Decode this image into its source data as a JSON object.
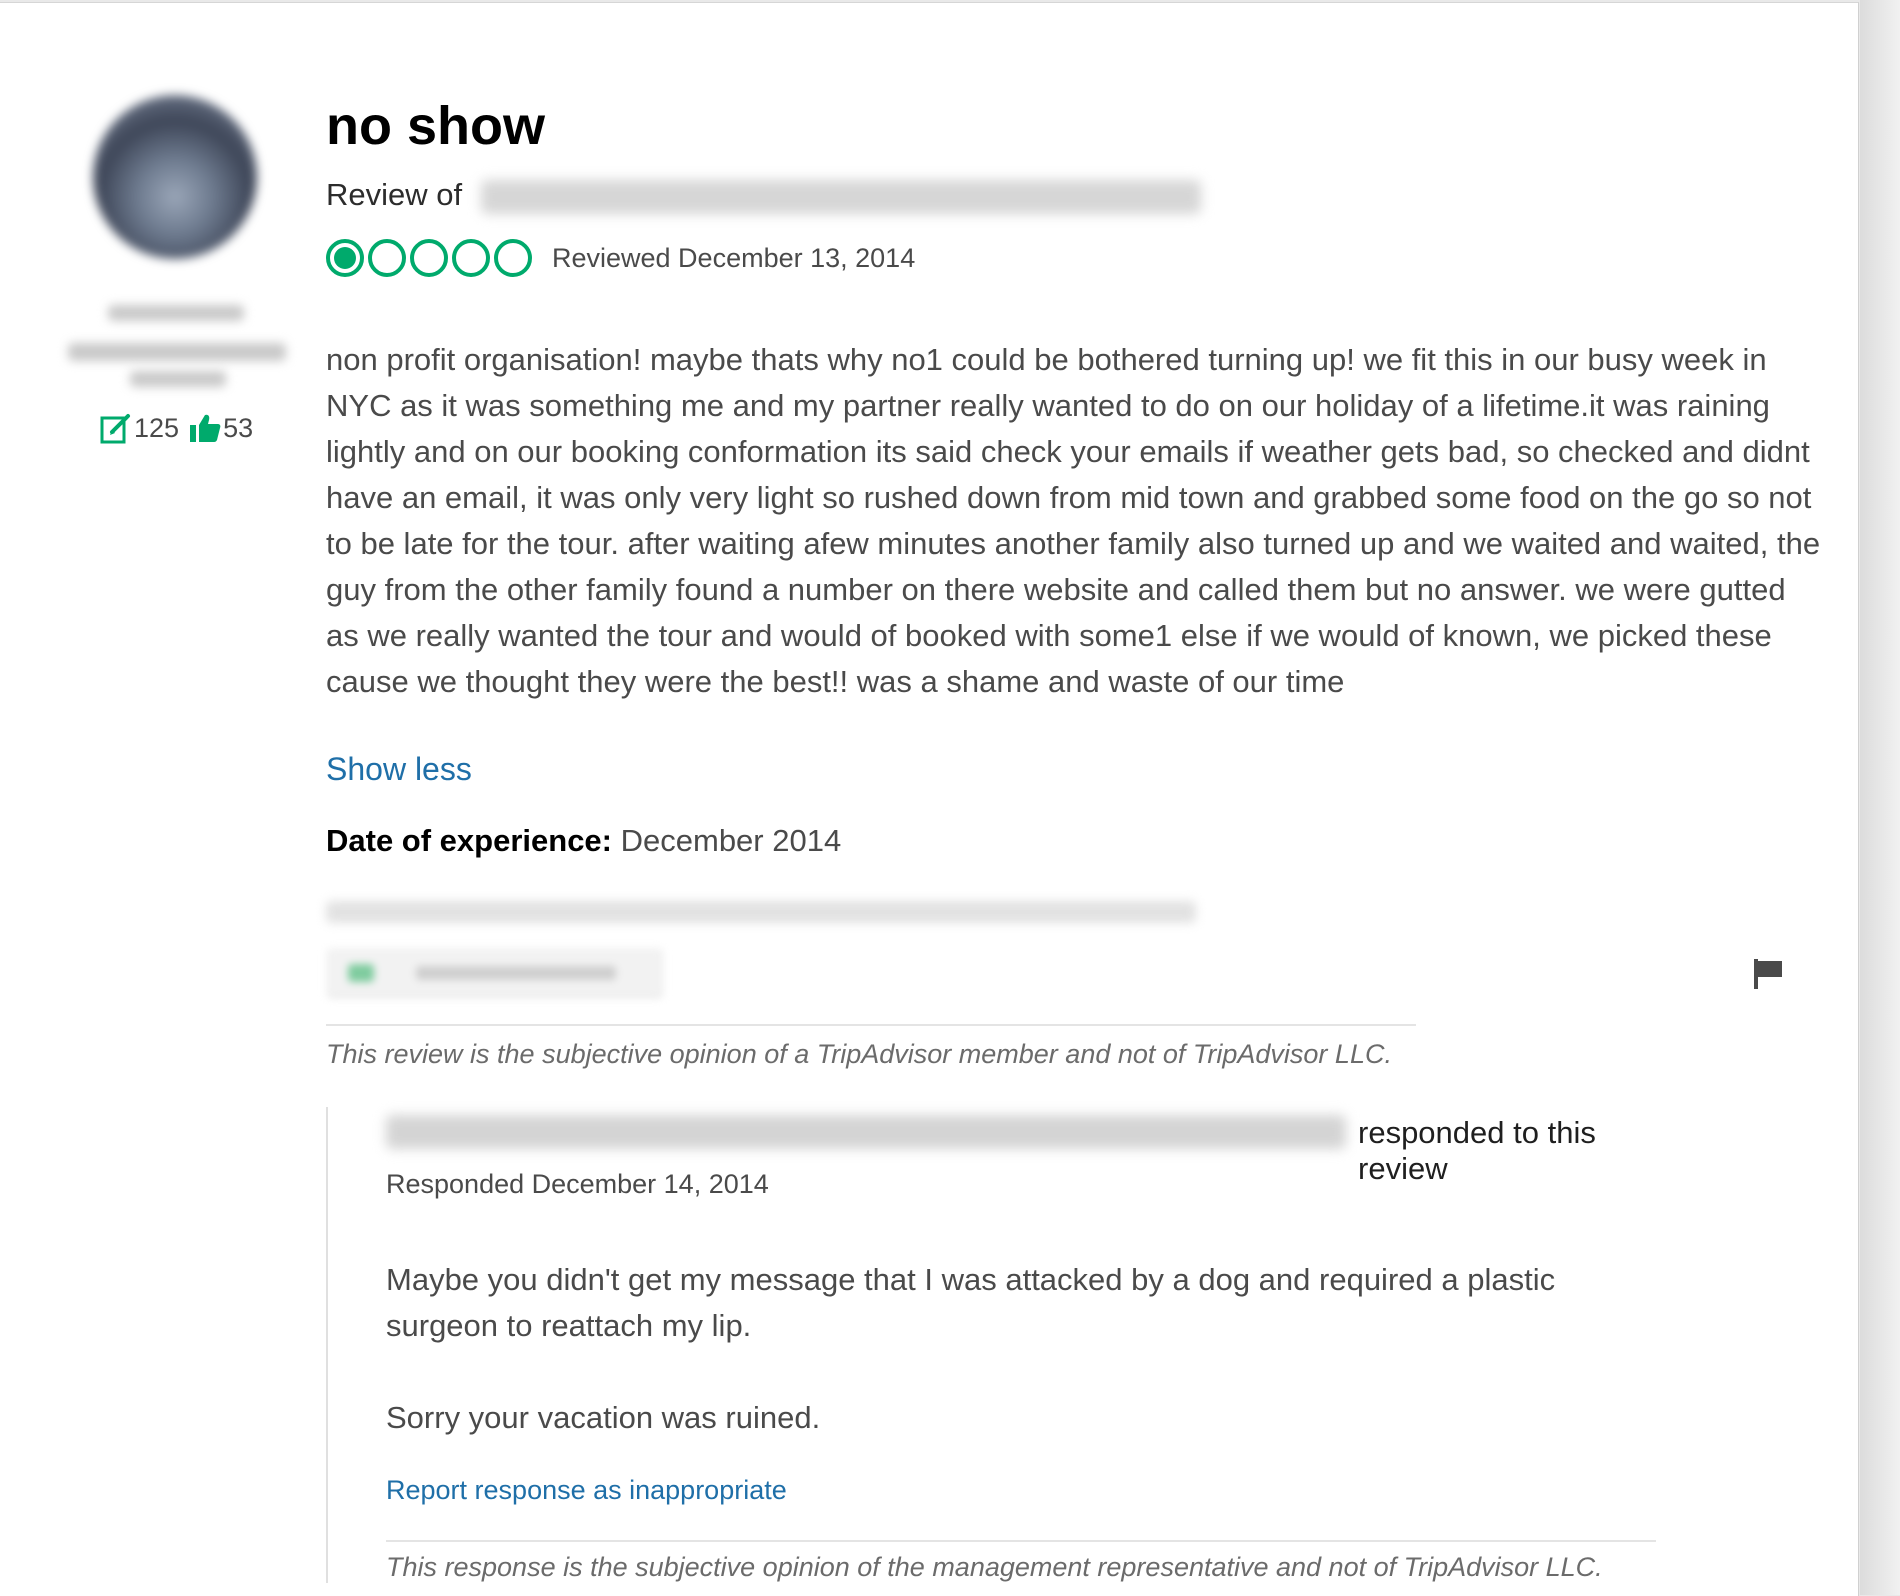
{
  "review": {
    "title": "no show",
    "review_of_label": "Review of",
    "rating": 1,
    "rating_max": 5,
    "reviewed_date": "Reviewed December 13, 2014",
    "text": "non profit organisation! maybe thats why no1 could be bothered turning up! we fit this in our busy week in NYC as it was something me and my partner really wanted to do on our holiday of a lifetime.it was raining lightly and on our booking conformation its said check your emails if weather gets bad, so checked and didnt have an email, it was only very light so rushed down from mid town and grabbed some food on the go so not to be late for the tour. after waiting afew minutes another family also turned up and we waited and waited, the guy from the other family found a number on there website and called them but no answer. we were gutted as we really wanted the tour and would of booked with some1 else if we would of known, we picked these cause we thought they were the best!! was a shame and waste of our time",
    "show_less_label": "Show less",
    "date_of_experience_label": "Date of experience:",
    "date_of_experience_value": "December 2014",
    "disclaimer": "This review is the subjective opinion of a TripAdvisor member and not of TripAdvisor LLC."
  },
  "reviewer": {
    "contributions": "125",
    "helpful_votes": "53"
  },
  "response": {
    "responded_suffix": "responded to this review",
    "responded_date": "Responded December 14, 2014",
    "paragraph_1": "Maybe you didn't get my message that I was attacked by a dog and required a plastic surgeon to reattach my lip.",
    "paragraph_2": "Sorry your vacation was ruined.",
    "report_label": "Report response as inappropriate",
    "disclaimer": "This response is the subjective opinion of the management representative and not of TripAdvisor LLC."
  },
  "colors": {
    "accent_green": "#00aa6c",
    "link_blue": "#1f6fa8"
  },
  "icons": [
    "edit-icon",
    "thumbs-up-icon",
    "flag-icon"
  ]
}
